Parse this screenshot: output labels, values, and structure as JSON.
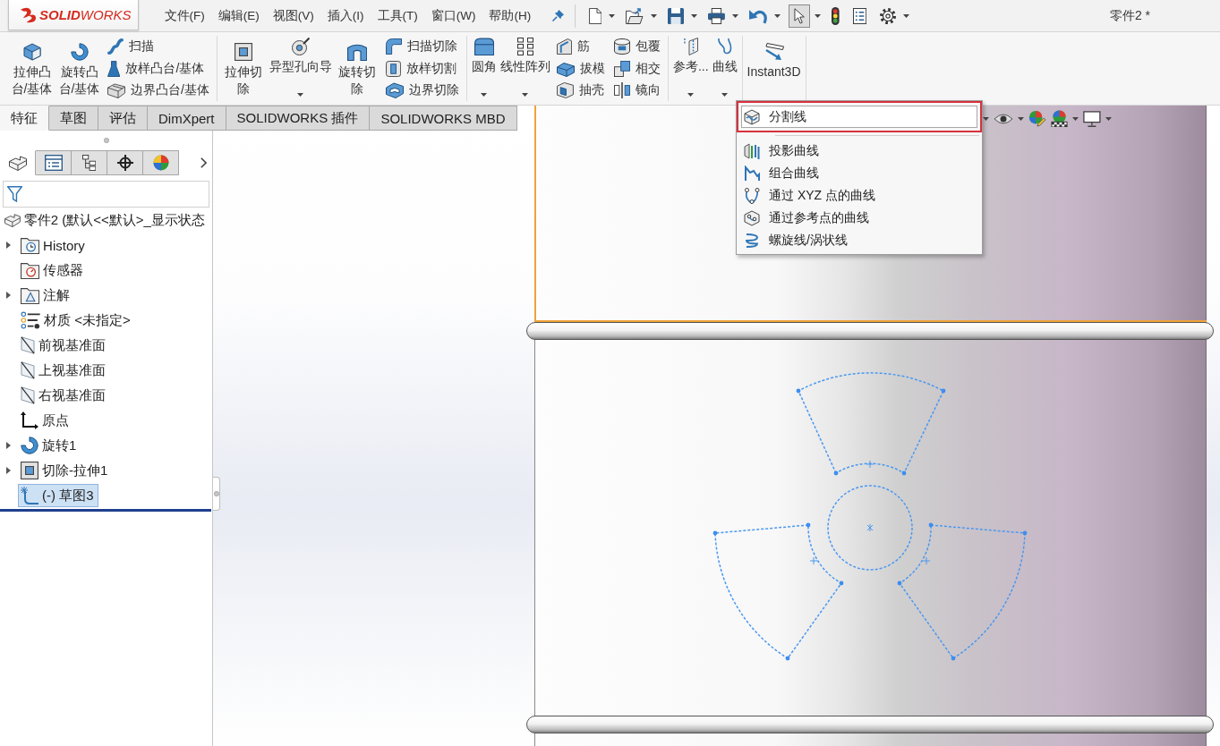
{
  "logo": {
    "text": "**SOLID**WORKS"
  },
  "menu_bar": [
    "文件(F)",
    "编辑(E)",
    "视图(V)",
    "插入(I)",
    "工具(T)",
    "窗口(W)",
    "帮助(H)"
  ],
  "quick_access": [
    {
      "selected": false
    },
    {
      "selected": false
    },
    {
      "selected": false
    },
    {
      "selected": false
    },
    {
      "selected": false
    },
    {
      "selected": true
    },
    {
      "selected": false
    },
    {
      "selected": false
    },
    {
      "selected": false
    }
  ],
  "window": {
    "title": "零件2 *"
  },
  "ribbon": {
    "groups": [
      [
        {
          "kind": "large",
          "label": "拉伸凸台/基体",
          "dropdown": false
        },
        {
          "kind": "large",
          "label": "旋转凸台/基体",
          "dropdown": false
        },
        {
          "kind": "stack",
          "items": [
            "扫描",
            "放样凸台/基体",
            "边界凸台/基体"
          ]
        }
      ],
      [
        {
          "kind": "large",
          "label": "拉伸切除",
          "dropdown": false
        },
        {
          "kind": "large",
          "label": "异型孔向导",
          "dropdown": true
        },
        {
          "kind": "large",
          "label": "旋转切除",
          "dropdown": false
        },
        {
          "kind": "stack",
          "items": [
            "扫描切除",
            "放样切割",
            "边界切除"
          ]
        }
      ],
      [
        {
          "kind": "large",
          "label": "圆角",
          "dropdown": true
        },
        {
          "kind": "large",
          "label": "线性阵列",
          "dropdown": true
        },
        {
          "kind": "stack",
          "items": [
            "筋",
            "拔模",
            "抽壳"
          ]
        },
        {
          "kind": "stack",
          "items": [
            "包覆",
            "相交",
            "镜向"
          ]
        }
      ],
      [
        {
          "kind": "large",
          "label": "参考...",
          "dropdown": true
        },
        {
          "kind": "large",
          "label": "曲线",
          "dropdown": true
        }
      ],
      [
        {
          "kind": "large",
          "label": "Instant3D",
          "dropdown": false
        }
      ]
    ]
  },
  "command_tabs": [
    {
      "label": "特征",
      "selected": true
    },
    {
      "label": "草图",
      "selected": false
    },
    {
      "label": "评估",
      "selected": false
    },
    {
      "label": "DimXpert",
      "selected": false
    },
    {
      "label": "SOLIDWORKS 插件",
      "selected": false
    },
    {
      "label": "SOLIDWORKS MBD",
      "selected": false
    }
  ],
  "feature_manager": {
    "tabs": [
      {
        "selected": true
      },
      {
        "selected": false
      },
      {
        "selected": false
      },
      {
        "selected": false
      },
      {
        "selected": false
      }
    ],
    "tree": {
      "label": "零件2 (默认<<默认>_显示状态",
      "selected": false,
      "children": [
        {
          "label": "History",
          "expandable": true,
          "selected": false
        },
        {
          "label": "传感器",
          "expandable": false,
          "selected": false
        },
        {
          "label": "注解",
          "expandable": true,
          "selected": false
        },
        {
          "label": "材质 <未指定>",
          "expandable": false,
          "selected": false
        },
        {
          "label": "前视基准面",
          "expandable": false,
          "selected": false
        },
        {
          "label": "上视基准面",
          "expandable": false,
          "selected": false
        },
        {
          "label": "右视基准面",
          "expandable": false,
          "selected": false
        },
        {
          "label": "原点",
          "expandable": false,
          "selected": false
        },
        {
          "label": "旋转1",
          "expandable": true,
          "selected": false
        },
        {
          "label": "切除-拉伸1",
          "expandable": true,
          "selected": false
        },
        {
          "label": "(-) 草图3",
          "expandable": false,
          "selected": true
        }
      ]
    }
  },
  "curves_menu": {
    "groups": [
      [
        {
          "label": "分割线",
          "selected": true
        }
      ],
      [
        {
          "label": "投影曲线",
          "selected": false
        },
        {
          "label": "组合曲线",
          "selected": false
        },
        {
          "label": "通过 XYZ 点的曲线",
          "selected": false
        },
        {
          "label": "通过参考点的曲线",
          "selected": false
        },
        {
          "label": "螺旋线/涡状线",
          "selected": false
        }
      ]
    ]
  }
}
